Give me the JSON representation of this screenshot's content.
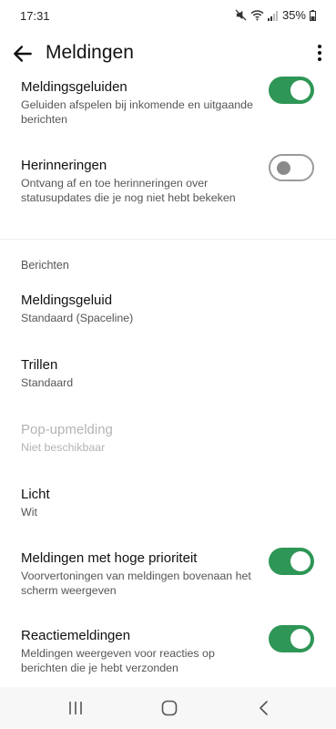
{
  "status_bar": {
    "time": "17:31",
    "battery": "35%",
    "icons": [
      "mute-icon",
      "wifi-icon",
      "signal-icon",
      "battery-icon"
    ]
  },
  "app_bar": {
    "title": "Meldingen"
  },
  "settings": {
    "meldingsgeluiden": {
      "title": "Meldingsgeluiden",
      "subtitle": "Geluiden afspelen bij inkomende en uitgaande berichten",
      "enabled": true
    },
    "herinneringen": {
      "title": "Herinneringen",
      "subtitle": "Ontvang af en toe herinneringen over statusupdates die je nog niet hebt bekeken",
      "enabled": false
    }
  },
  "section": {
    "label": "Berichten"
  },
  "berichten": {
    "meldingsgeluid": {
      "title": "Meldingsgeluid",
      "value": "Standaard (Spaceline)"
    },
    "trillen": {
      "title": "Trillen",
      "value": "Standaard"
    },
    "pop_upmelding": {
      "title": "Pop-upmelding",
      "value": "Niet beschikbaar",
      "disabled": true
    },
    "licht": {
      "title": "Licht",
      "value": "Wit"
    },
    "hoge_prioriteit": {
      "title": "Meldingen met hoge prioriteit",
      "subtitle": "Voorvertoningen van meldingen bovenaan het scherm weergeven",
      "enabled": true
    },
    "reactiemeldingen": {
      "title": "Reactiemeldingen",
      "subtitle": "Meldingen weergeven voor reacties op berichten die je hebt verzonden",
      "enabled": true
    }
  },
  "colors": {
    "accent": "#2e9656",
    "toggle_off_border": "#9a9a9a",
    "disabled_text": "#b4b4b4"
  }
}
